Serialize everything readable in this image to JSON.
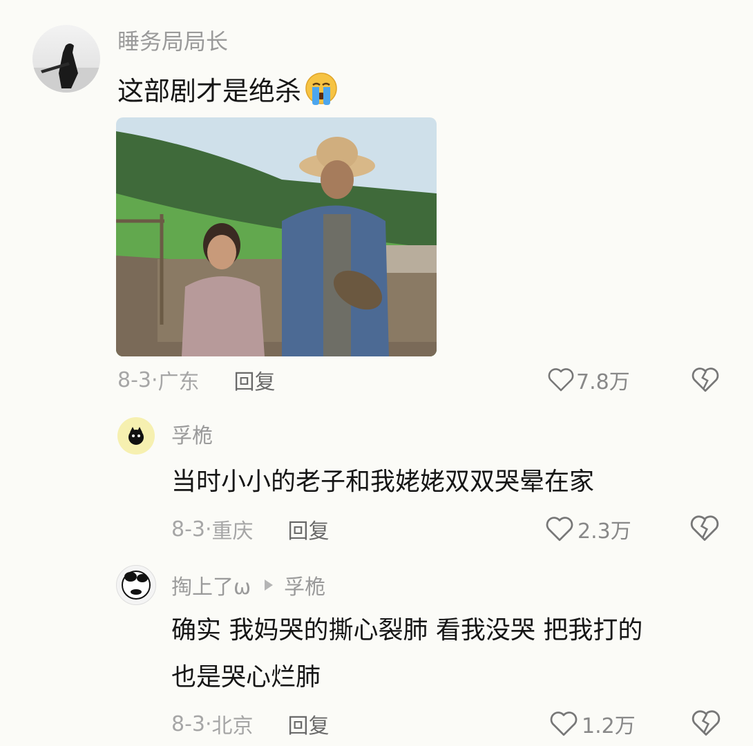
{
  "comment": {
    "username": "睡务局局长",
    "text": "这部剧才是绝杀",
    "emoji": "loudly-crying-face-emoji",
    "date": "8-3",
    "location": "广东",
    "reply_label": "回复",
    "likes": "7.8万"
  },
  "replies": [
    {
      "username": "孚桅",
      "text_lines": [
        "当时小小的老子和我姥姥双双哭晕在家"
      ],
      "date": "8-3",
      "location": "重庆",
      "reply_label": "回复",
      "likes": "2.3万"
    },
    {
      "username": "掏上了ω",
      "reply_to": "孚桅",
      "text_lines": [
        "确实 我妈哭的撕心裂肺 看我没哭 把我打的",
        "也是哭心烂肺"
      ],
      "date": "8-3",
      "location": "北京",
      "reply_label": "回复",
      "likes": "1.2万"
    }
  ],
  "colors": {
    "background": "#fbfbf7",
    "text": "#161616",
    "secondary": "#9a9a9a"
  }
}
